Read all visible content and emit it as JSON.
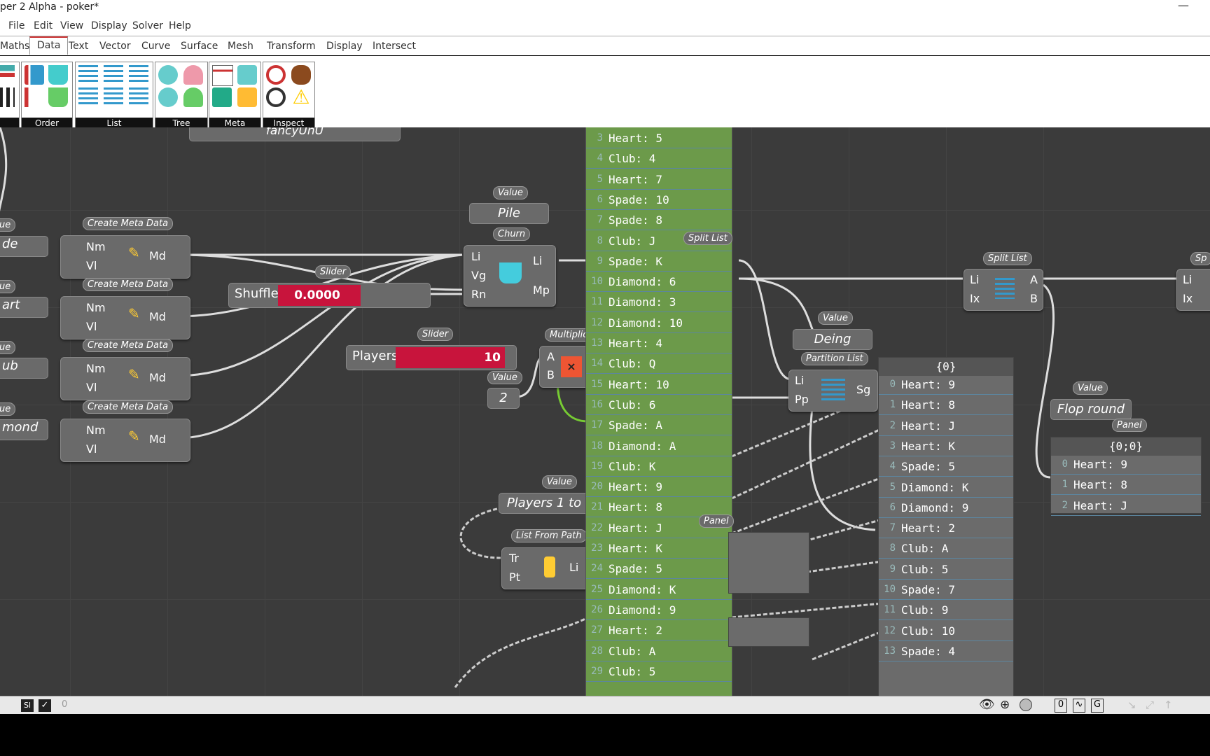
{
  "window": {
    "title": "per 2 Alpha - poker*",
    "minimize": "—"
  },
  "menu": [
    "File",
    "Edit",
    "View",
    "Display",
    "Solver",
    "Help"
  ],
  "tabs": {
    "items": [
      "Maths",
      "Data",
      "Text",
      "Vector",
      "Curve",
      "Surface",
      "Mesh",
      "Transform",
      "Display",
      "Intersect"
    ],
    "active": "Data"
  },
  "ribbon": {
    "groups": [
      "Order",
      "List",
      "Tree",
      "Meta",
      "Inspect"
    ]
  },
  "canvas": {
    "top_node": "fancyUnU",
    "meta_tag": "Create Meta Data",
    "meta_ports": {
      "nm": "Nm",
      "vl": "Vl",
      "md": "Md"
    },
    "left_values": [
      "de",
      "art",
      "ub",
      "mond"
    ],
    "left_tag": "ue",
    "pile": {
      "tag": "Value",
      "label": "Pile"
    },
    "churn": {
      "tag": "Churn",
      "li": "Li",
      "vg": "Vg",
      "rn": "Rn",
      "li_out": "Li",
      "mp": "Mp"
    },
    "shuffle": {
      "tag": "Slider",
      "label": "Shuffle",
      "value": "0.0000",
      "fraction": 0.0
    },
    "players": {
      "tag": "Slider",
      "label": "Players",
      "value": "10"
    },
    "multiplication": {
      "tag": "Multiplication",
      "a": "A",
      "b": "B"
    },
    "two": {
      "tag": "Value",
      "label": "2"
    },
    "players_to": {
      "tag": "Value",
      "label": "Players 1 to"
    },
    "list_from_path": {
      "tag": "List From Path",
      "tr": "Tr",
      "pt": "Pt",
      "li": "Li"
    },
    "split_list_1": {
      "tag": "Split List"
    },
    "split_list_2": {
      "tag": "Split List",
      "li": "Li",
      "ix": "Ix",
      "a": "A",
      "b": "B"
    },
    "split_list_3": {
      "tag": "Sp",
      "li": "Li",
      "ix": "Ix"
    },
    "deing": {
      "tag": "Value",
      "label": "Deing"
    },
    "partition": {
      "tag": "Partition List",
      "li": "Li",
      "pp": "Pp",
      "sg": "Sg"
    },
    "flop": {
      "tag": "Value",
      "label": "Flop round"
    },
    "panel_tag": "Panel",
    "green_panel": [
      {
        "i": "3",
        "t": "Heart: 5"
      },
      {
        "i": "4",
        "t": "Club: 4"
      },
      {
        "i": "5",
        "t": "Heart: 7"
      },
      {
        "i": "6",
        "t": "Spade: 10"
      },
      {
        "i": "7",
        "t": "Spade: 8"
      },
      {
        "i": "8",
        "t": "Club: J"
      },
      {
        "i": "9",
        "t": "Spade: K"
      },
      {
        "i": "10",
        "t": "Diamond: 6"
      },
      {
        "i": "11",
        "t": "Diamond: 3"
      },
      {
        "i": "12",
        "t": "Diamond: 10"
      },
      {
        "i": "13",
        "t": "Heart: 4"
      },
      {
        "i": "14",
        "t": "Club: Q"
      },
      {
        "i": "15",
        "t": "Heart: 10"
      },
      {
        "i": "16",
        "t": "Club: 6"
      },
      {
        "i": "17",
        "t": "Spade: A"
      },
      {
        "i": "18",
        "t": "Diamond: A"
      },
      {
        "i": "19",
        "t": "Club: K"
      },
      {
        "i": "20",
        "t": "Heart: 9"
      },
      {
        "i": "21",
        "t": "Heart: 8"
      },
      {
        "i": "22",
        "t": "Heart: J"
      },
      {
        "i": "23",
        "t": "Heart: K"
      },
      {
        "i": "24",
        "t": "Spade: 5"
      },
      {
        "i": "25",
        "t": "Diamond: K"
      },
      {
        "i": "26",
        "t": "Diamond: 9"
      },
      {
        "i": "27",
        "t": "Heart: 2"
      },
      {
        "i": "28",
        "t": "Club: A"
      },
      {
        "i": "29",
        "t": "Club: 5"
      }
    ],
    "panel0": {
      "header": "{0}",
      "rows": [
        {
          "i": "0",
          "t": "Heart: 9"
        },
        {
          "i": "1",
          "t": "Heart: 8"
        },
        {
          "i": "2",
          "t": "Heart: J"
        },
        {
          "i": "3",
          "t": "Heart: K"
        },
        {
          "i": "4",
          "t": "Spade: 5"
        },
        {
          "i": "5",
          "t": "Diamond: K"
        },
        {
          "i": "6",
          "t": "Diamond: 9"
        },
        {
          "i": "7",
          "t": "Heart: 2"
        },
        {
          "i": "8",
          "t": "Club: A"
        },
        {
          "i": "9",
          "t": "Club: 5"
        },
        {
          "i": "10",
          "t": "Spade: 7"
        },
        {
          "i": "11",
          "t": "Club: 9"
        },
        {
          "i": "12",
          "t": "Club: 10"
        },
        {
          "i": "13",
          "t": "Spade: 4"
        }
      ]
    },
    "panel00": {
      "header": "{0;0}",
      "rows": [
        {
          "i": "0",
          "t": "Heart: 9"
        },
        {
          "i": "1",
          "t": "Heart: 8"
        },
        {
          "i": "2",
          "t": "Heart: J"
        }
      ]
    }
  },
  "status": {
    "count": "0"
  },
  "colors": {
    "canvas": "#3b3b3b",
    "slider": "#c8143c",
    "panel_green": "#6c9a4a"
  }
}
